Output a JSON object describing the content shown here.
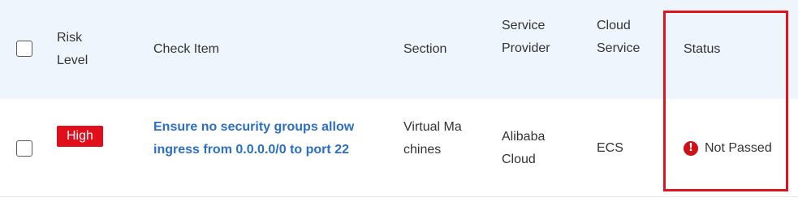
{
  "table": {
    "headers": {
      "risk_level": "Risk Level",
      "check_item": "Check Item",
      "section": "Section",
      "service_provider": "Service Provider",
      "cloud_service": "Cloud Service",
      "status": "Status"
    },
    "rows": [
      {
        "risk_level": "High",
        "check_item": "Ensure no security groups allow ingress from 0.0.0.0/0 to port 22",
        "section": "Virtual Machines",
        "service_provider": "Alibaba Cloud",
        "cloud_service": "ECS",
        "status": "Not Passed",
        "status_icon": "exclamation-circle-icon"
      }
    ]
  },
  "colors": {
    "header_background": "#eef5fc",
    "risk_high": "#e00f1b",
    "link": "#2b6fc4",
    "status_not_passed": "#cc1118",
    "highlight_border": "#e0141c"
  }
}
